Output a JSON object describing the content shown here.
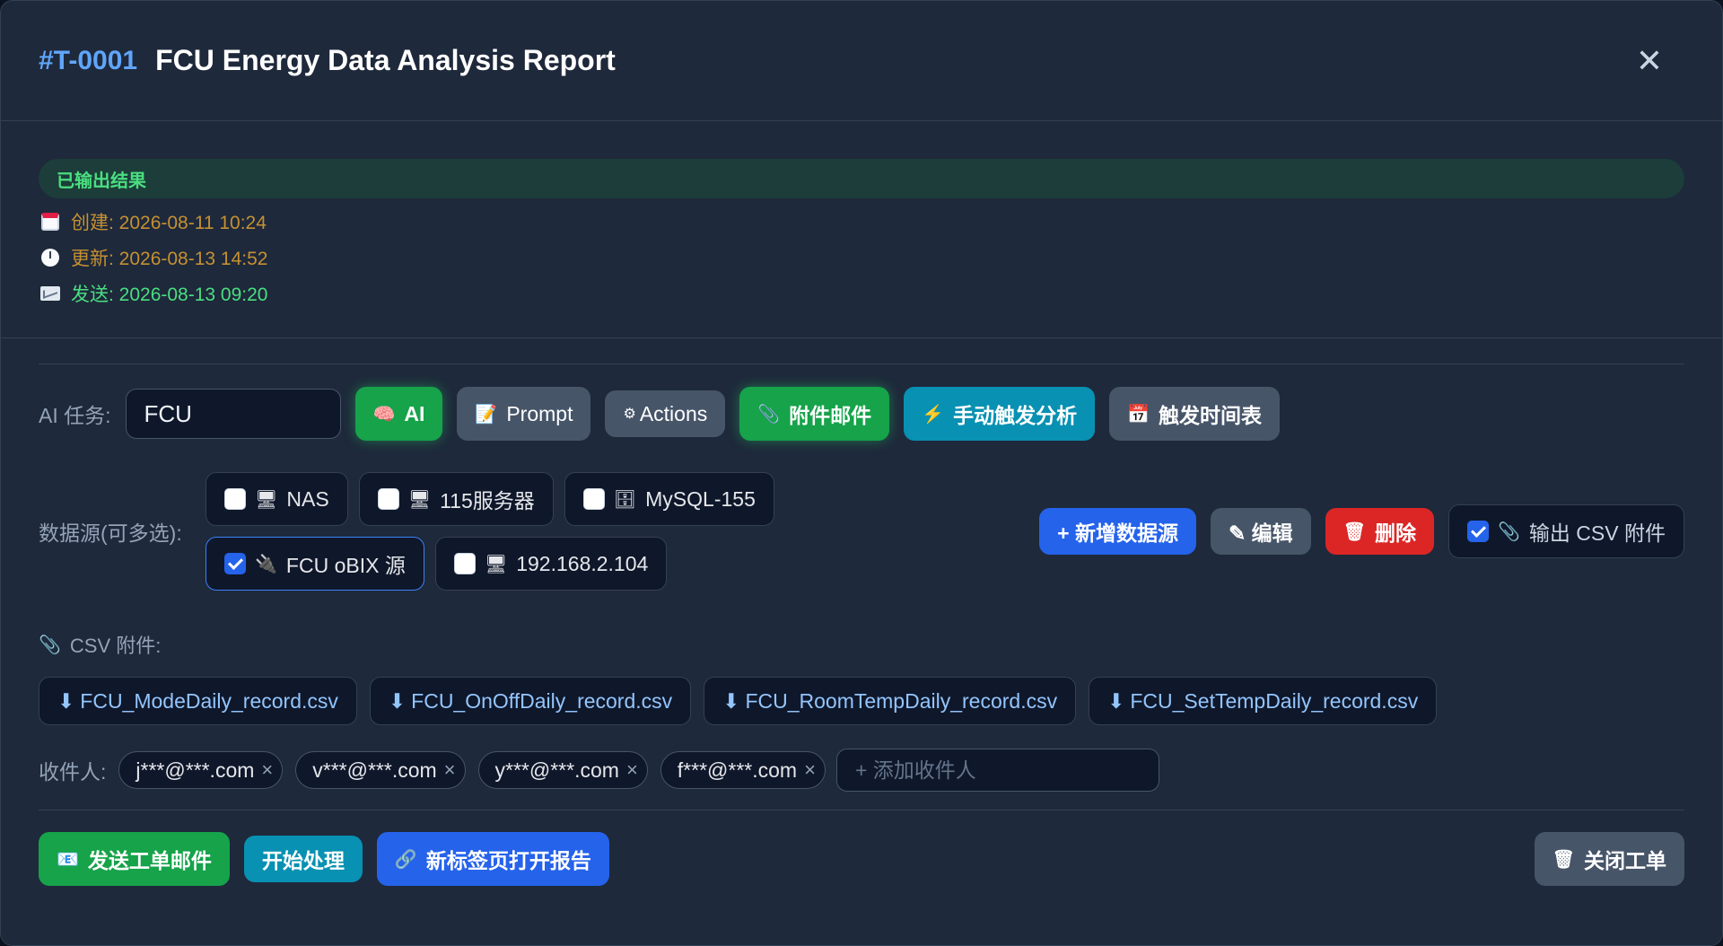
{
  "header": {
    "ticket_id": "#T-0001",
    "title": "FCU Energy Data Analysis Report"
  },
  "status": {
    "label": "已输出结果"
  },
  "meta": {
    "created": "创建: 2026-08-11 10:24",
    "updated": "更新: 2026-08-13 14:52",
    "sent": "发送: 2026-08-13 09:20"
  },
  "ai_task": {
    "label": "AI 任务:",
    "input_value": "FCU",
    "buttons": {
      "ai": "AI",
      "prompt": "Prompt",
      "actions": "Actions",
      "attach_mail": "附件邮件",
      "trigger": "手动触发分析",
      "schedule": "触发时间表"
    }
  },
  "datasources": {
    "label": "数据源(可多选):",
    "items": [
      {
        "label": "NAS",
        "checked": false,
        "icon": "monitor-icon"
      },
      {
        "label": "115服务器",
        "checked": false,
        "icon": "monitor-icon"
      },
      {
        "label": "MySQL-155",
        "checked": false,
        "icon": "cabinet-icon"
      },
      {
        "label": "FCU oBIX 源",
        "checked": true,
        "icon": "plug-icon"
      },
      {
        "label": "192.168.2.104",
        "checked": false,
        "icon": "monitor-icon"
      }
    ],
    "add_label": "+ 新增数据源",
    "edit_label": "✎ 编辑",
    "delete_label": "删除",
    "output_csv_label": "输出 CSV 附件",
    "output_csv_checked": true
  },
  "csv": {
    "label": "CSV 附件:",
    "files": [
      "FCU_ModeDaily_record.csv",
      "FCU_OnOffDaily_record.csv",
      "FCU_RoomTempDaily_record.csv",
      "FCU_SetTempDaily_record.csv"
    ]
  },
  "recipients": {
    "label": "收件人:",
    "list": [
      "j***@***.com",
      "v***@***.com",
      "y***@***.com",
      "f***@***.com"
    ],
    "placeholder": "+ 添加收件人"
  },
  "footer": {
    "send": "发送工单邮件",
    "start": "开始处理",
    "open_report": "新标签页打开报告",
    "close": "关闭工单"
  }
}
